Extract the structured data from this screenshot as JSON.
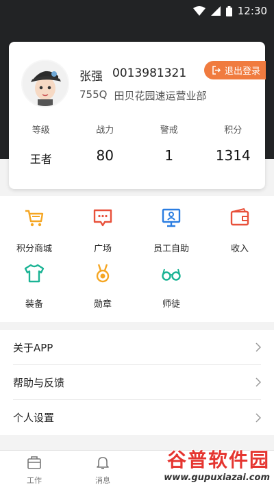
{
  "status_bar": {
    "time": "12:30"
  },
  "profile": {
    "name": "张强",
    "id": "0013981321",
    "code": "755Q",
    "department": "田贝花园速运营业部",
    "logout_label": "退出登录"
  },
  "stats": [
    {
      "label": "等级",
      "value": "王者"
    },
    {
      "label": "战力",
      "value": "80"
    },
    {
      "label": "警戒",
      "value": "1"
    },
    {
      "label": "积分",
      "value": "1314"
    }
  ],
  "grid": [
    {
      "label": "积分商城",
      "icon": "cart-icon"
    },
    {
      "label": "广场",
      "icon": "chat-bubble-icon"
    },
    {
      "label": "员工自助",
      "icon": "monitor-user-icon"
    },
    {
      "label": "收入",
      "icon": "wallet-icon"
    },
    {
      "label": "装备",
      "icon": "shirt-icon"
    },
    {
      "label": "勋章",
      "icon": "medal-icon"
    },
    {
      "label": "师徒",
      "icon": "glasses-icon"
    }
  ],
  "menu": [
    {
      "label": "关于APP"
    },
    {
      "label": "帮助与反馈"
    },
    {
      "label": "个人设置"
    }
  ],
  "tabs": [
    {
      "label": "工作",
      "icon": "briefcase-icon"
    },
    {
      "label": "消息",
      "icon": "bell-icon"
    }
  ],
  "watermark": {
    "title": "谷普软件园",
    "url": "www.gupuxiazai.com"
  },
  "colors": {
    "accent": "#f07b3f",
    "header": "#222325",
    "orange_icon": "#f5a623",
    "red_icon": "#e8503a",
    "blue_icon": "#2a7de1",
    "teal_icon": "#1ab394"
  }
}
